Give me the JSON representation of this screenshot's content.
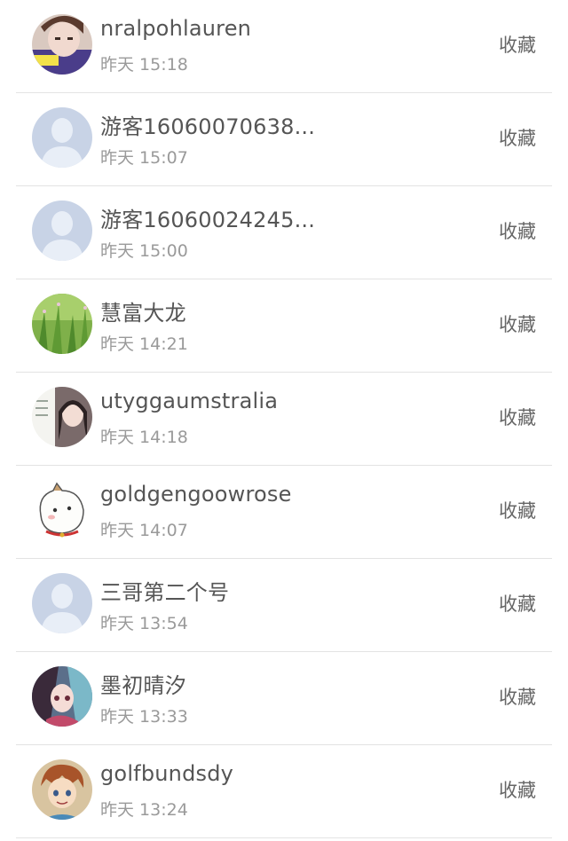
{
  "items": [
    {
      "name": "nralpohlauren",
      "time": "昨天 15:18",
      "action": "收藏",
      "avatar": "photo-girl-avatar"
    },
    {
      "name": "游客16060070638...",
      "time": "昨天 15:07",
      "action": "收藏",
      "avatar": "default-avatar"
    },
    {
      "name": "游客16060024245...",
      "time": "昨天 15:00",
      "action": "收藏",
      "avatar": "default-avatar"
    },
    {
      "name": "慧富大龙",
      "time": "昨天 14:21",
      "action": "收藏",
      "avatar": "grass-photo-avatar"
    },
    {
      "name": "utyggaumstralia",
      "time": "昨天 14:18",
      "action": "收藏",
      "avatar": "photo-girl-avatar"
    },
    {
      "name": "goldgengoowrose",
      "time": "昨天 14:07",
      "action": "收藏",
      "avatar": "cartoon-cat-avatar"
    },
    {
      "name": "三哥第二个号",
      "time": "昨天 13:54",
      "action": "收藏",
      "avatar": "default-avatar"
    },
    {
      "name": "墨初晴汐",
      "time": "昨天 13:33",
      "action": "收藏",
      "avatar": "anime-girl-avatar"
    },
    {
      "name": "golfbundsdy",
      "time": "昨天 13:24",
      "action": "收藏",
      "avatar": "cartoon-boy-avatar"
    }
  ],
  "colors": {
    "default_avatar_bg": "#c8d3e6",
    "default_avatar_fg": "#e8eef7",
    "divider": "#e3e3e3"
  }
}
